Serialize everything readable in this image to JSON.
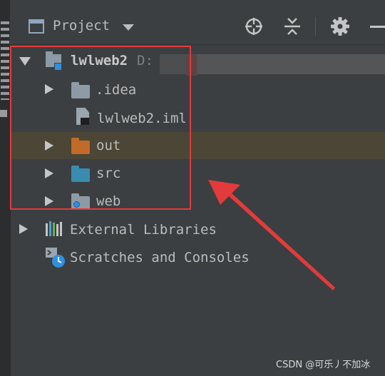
{
  "panel": {
    "title": "Project"
  },
  "toolbar": {
    "icons": [
      "locate-icon",
      "collapse-all-icon",
      "gear-icon",
      "minimize-icon"
    ]
  },
  "tree": {
    "root": {
      "name": "lwlweb2",
      "path_prefix": "D:"
    },
    "children": [
      {
        "name": ".idea",
        "icon": "folder-icon",
        "expandable": true
      },
      {
        "name": "lwlweb2.iml",
        "icon": "module-file-icon",
        "expandable": false
      },
      {
        "name": "out",
        "icon": "excluded-folder-icon",
        "expandable": true,
        "highlighted": true
      },
      {
        "name": "src",
        "icon": "source-folder-icon",
        "expandable": true
      },
      {
        "name": "web",
        "icon": "web-folder-icon",
        "expandable": true
      }
    ],
    "external_libraries": "External Libraries",
    "scratches": "Scratches and Consoles"
  },
  "colors": {
    "background": "#3c3f41",
    "highlight_row": "#4b4636",
    "excluded_folder": "#c16b28",
    "source_folder": "#3a8bb0",
    "annotation_red": "#e23b3b"
  },
  "watermark": "CSDN @可乐丿不加冰"
}
